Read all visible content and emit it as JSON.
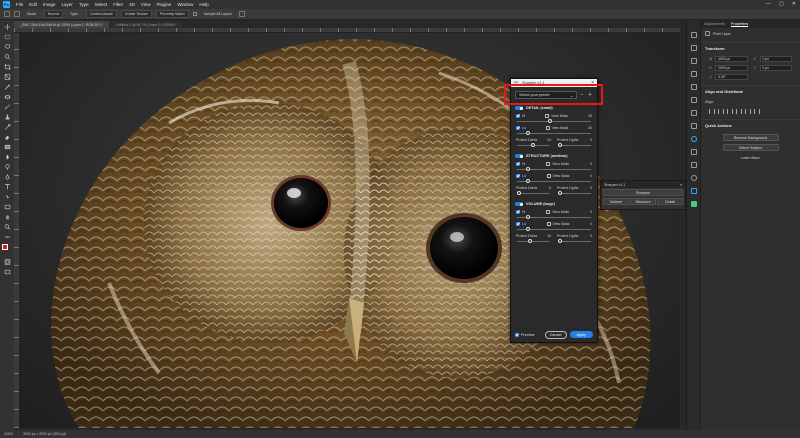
{
  "menubar": {
    "logo": "Ps",
    "items": [
      "File",
      "Edit",
      "Image",
      "Layer",
      "Type",
      "Select",
      "Filter",
      "3D",
      "View",
      "Plugins",
      "Window",
      "Help"
    ],
    "window_controls": [
      "—",
      "▢",
      "✕"
    ]
  },
  "options": {
    "mode_label": "Mode:",
    "mode_value": "Normal",
    "type_label": "Type:",
    "content_aware": "Content-Aware",
    "create_texture": "Create Texture",
    "proximity_match": "Proximity Match",
    "sample_all_layers": "Sample All Layers"
  },
  "tabs": [
    {
      "label": "_SMC7354-Edit-Edit.tif @ 100% (Layer 1, RGB/16*) *"
    },
    {
      "label": "Untitled-1 @ 66.7% (Layer 0, RGB/8) *"
    }
  ],
  "status": {
    "zoom": "100%",
    "doc": "3000 px x 2000 px (300 ppi)"
  },
  "properties": {
    "tab_adjustments": "Adjustments",
    "tab_properties": "Properties",
    "layer_kind": "Pixel Layer",
    "transform_title": "Transform",
    "w_label": "W",
    "w_value": "4000 px",
    "h_label": "H",
    "h_value": "2000 px",
    "x_label": "X",
    "x_value": "0 px",
    "y_label": "Y",
    "y_value": "0 px",
    "angle_value": "0.00°",
    "align_title": "Align and Distribute",
    "align_label": "Align:",
    "quick_actions_title": "Quick Actions",
    "qa_remove_bg": "Remove Background",
    "qa_select_subject": "Select Subject",
    "qa_more": "Learn More"
  },
  "sharpen_panel": {
    "title": "Sharpen v1.1",
    "top_button": "Sharpen",
    "buttons": [
      "Volume",
      "Structure",
      "Detail"
    ]
  },
  "plugin": {
    "title": "FF - Sharpen v1.1",
    "preset_placeholder": "Select your preset",
    "preset_minus": "−",
    "preset_plus": "+",
    "sections": [
      {
        "title": "DETAIL (small)",
        "hi_label": "Hi",
        "hi_mask": "View Mask",
        "hi_value": "25",
        "hi_pos": 0.45,
        "lo_label": "Lo",
        "lo_mask": "View Mask",
        "lo_value": "30",
        "lo_pos": 0.15,
        "darks_label": "Protect Darks",
        "darks_value": "24",
        "darks_pos": 0.48,
        "lights_label": "Protect Lights",
        "lights_value": "0",
        "lights_pos": 0.05
      },
      {
        "title": "STRUCTURE (medium)",
        "hi_label": "Hi",
        "hi_mask": "View Mask",
        "hi_value": "0",
        "hi_pos": 0.15,
        "lo_label": "Lo",
        "lo_mask": "View Mask",
        "lo_value": "0",
        "lo_pos": 0.15,
        "darks_label": "Protect Darks",
        "darks_value": "0",
        "darks_pos": 0.05,
        "lights_label": "Protect Lights",
        "lights_value": "0",
        "lights_pos": 0.05
      },
      {
        "title": "VOLUME (large)",
        "hi_label": "Hi",
        "hi_mask": "View Mask",
        "hi_value": "0",
        "hi_pos": 0.15,
        "lo_label": "Lo",
        "lo_mask": "View Mask",
        "lo_value": "0",
        "lo_pos": 0.15,
        "darks_label": "Protect Darks",
        "darks_value": "16",
        "darks_pos": 0.4,
        "lights_label": "Protect Lights",
        "lights_value": "0",
        "lights_pos": 0.05
      }
    ],
    "preview_label": "Preview",
    "cancel_label": "Cancel",
    "apply_label": "Apply"
  },
  "colors": {
    "accent": "#2680eb",
    "highlight": "#e81919",
    "foreground_swatch": "#e31b1b"
  },
  "icons": [
    "move-icon",
    "marquee-icon",
    "lasso-icon",
    "quick-select-icon",
    "crop-icon",
    "frame-icon",
    "eyedropper-icon",
    "healing-brush-icon",
    "brush-icon",
    "clone-stamp-icon",
    "history-brush-icon",
    "eraser-icon",
    "gradient-icon",
    "blur-icon",
    "dodge-icon",
    "pen-icon",
    "type-icon",
    "path-select-icon",
    "rectangle-icon",
    "hand-icon",
    "zoom-icon"
  ]
}
